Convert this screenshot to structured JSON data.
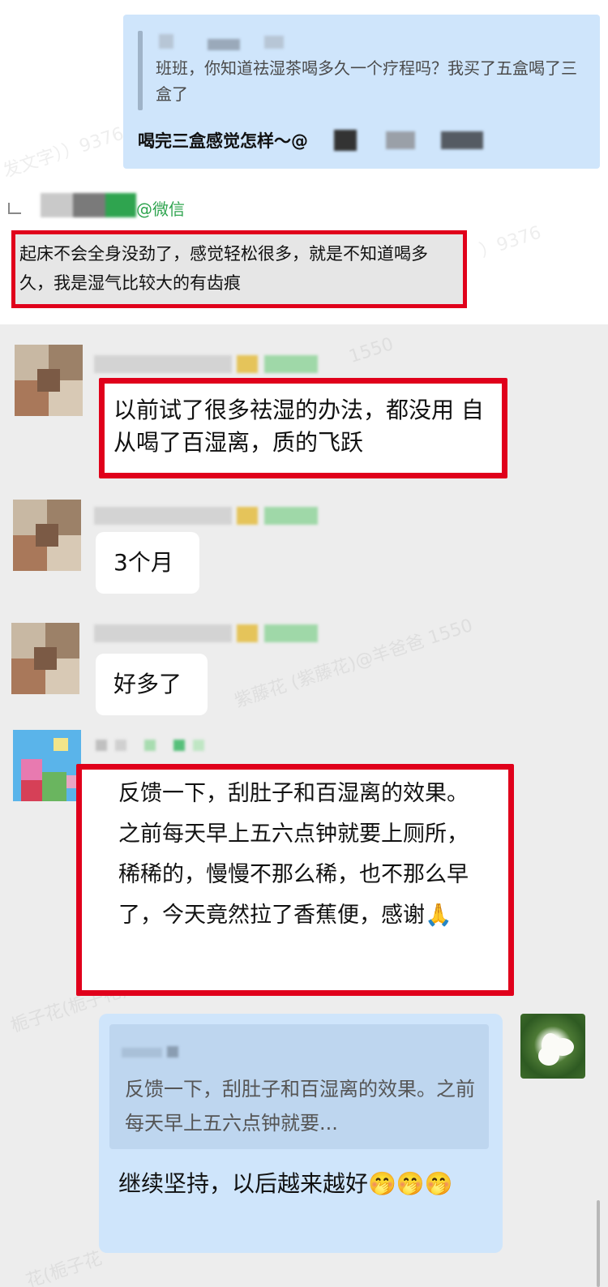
{
  "colors": {
    "highlight_red": "#e0001b",
    "wechat_green": "#2fa44f",
    "quote_blue": "#cfe5fb",
    "chat_bg": "#ededed"
  },
  "top_card": {
    "quoted_text": "班班，你知道祛湿茶喝多久一个疗程吗？我买了五盒喝了三盒了",
    "reply_text": "喝完三盒感觉怎样～@"
  },
  "wechat_tag": "@微信",
  "grey_reply": {
    "text": "起床不会全身没劲了，感觉轻松很多，就是不知道喝多久，我是湿气比较大的有齿痕"
  },
  "messages": [
    {
      "text": "以前试了很多祛湿的办法，都没用 自从喝了百湿离，质的飞跃"
    },
    {
      "text": "3个月"
    },
    {
      "text": "好多了"
    },
    {
      "text": " 反馈一下，刮肚子和百湿离的效果。之前每天早上五六点钟就要上厕所，稀稀的，慢慢不那么稀，也不那么早了，今天竟然拉了香蕉便，感谢🙏"
    }
  ],
  "own_reply": {
    "quoted_text": "反馈一下，刮肚子和百湿离的效果。之前每天早上五六点钟就要...",
    "text": "继续坚持，以后越来越好🤭🤭🤭"
  },
  "watermarks": [
    "发文字））9376",
    "）9376",
    "1550",
    "紫藤花 (紫藤花)@羊爸爸 1550",
    "栀子花(栀子花)",
    "花(栀子花"
  ],
  "icons": {
    "reply_corner": "reply-corner-icon",
    "pray": "pray-emoji",
    "shy": "shy-face-emoji"
  }
}
